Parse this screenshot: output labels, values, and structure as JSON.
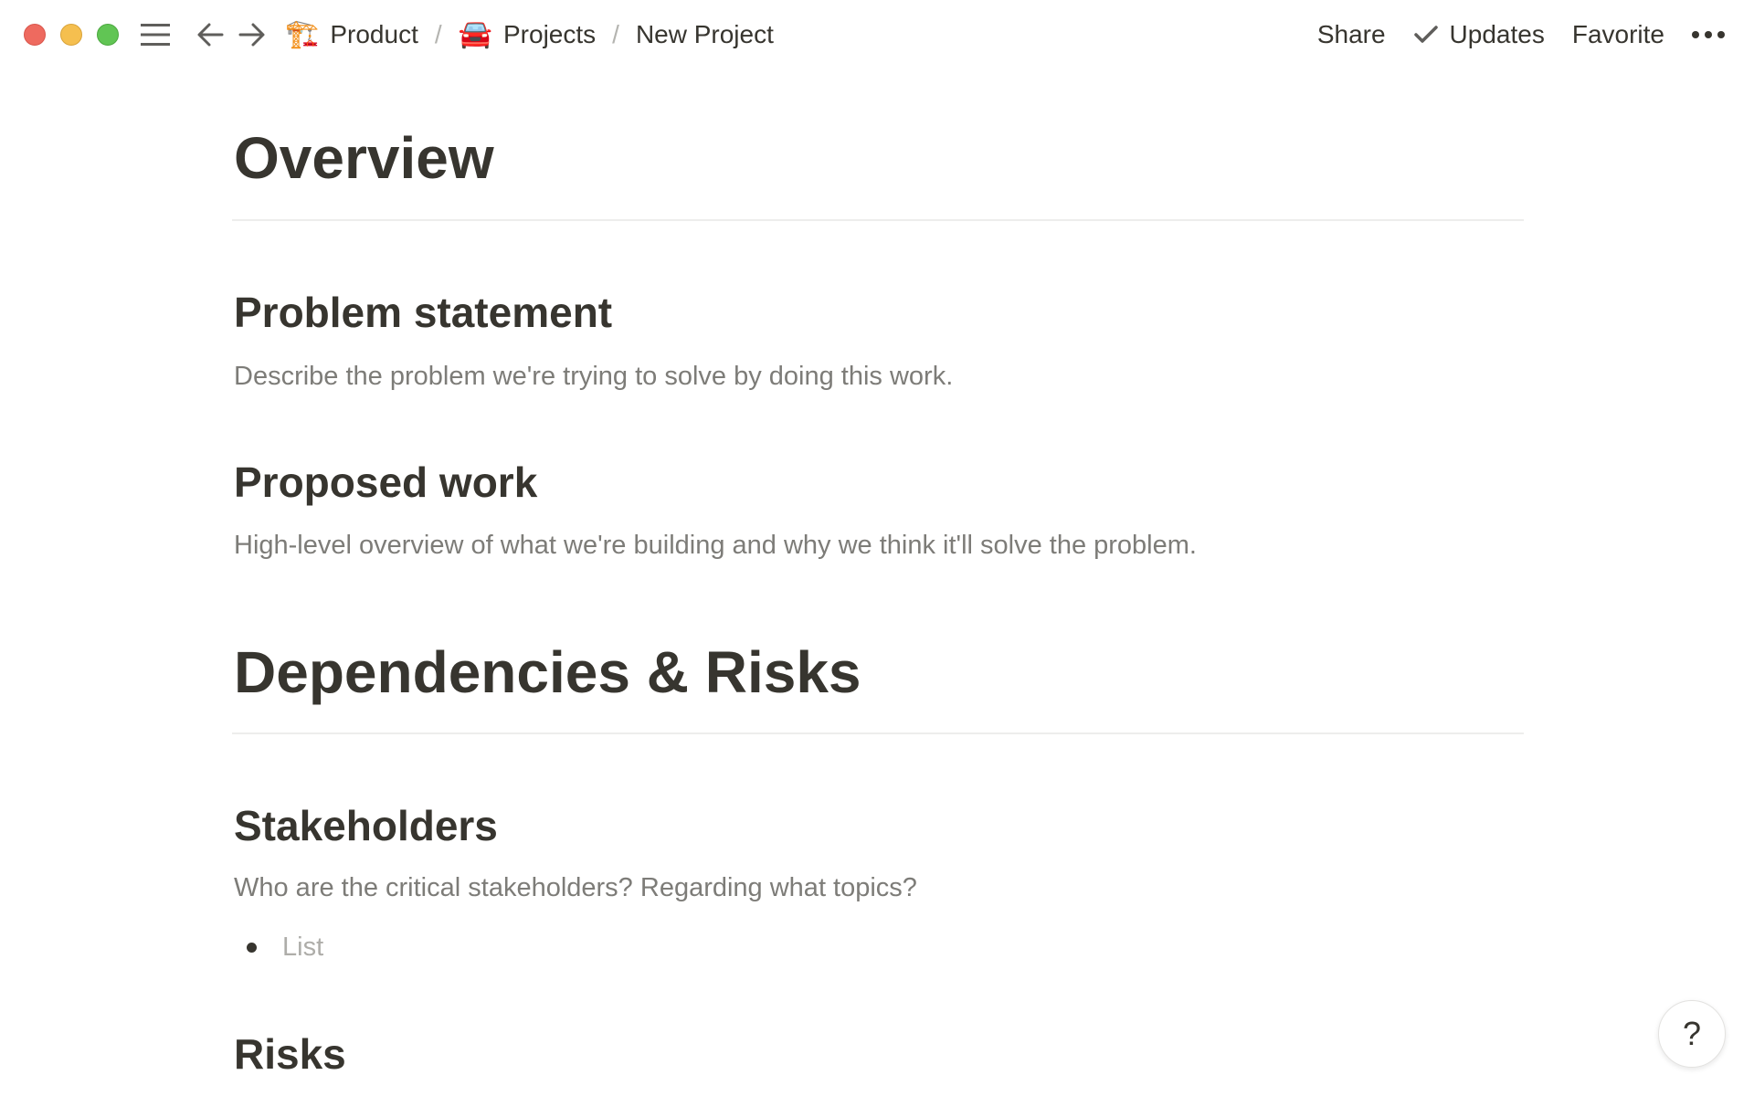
{
  "window": {
    "controls": [
      "close",
      "minimize",
      "zoom"
    ]
  },
  "toolbar": {
    "menu_icon": "hamburger-icon",
    "back_icon": "arrow-left-icon",
    "forward_icon": "arrow-right-icon",
    "breadcrumb": [
      {
        "emoji": "🏗️",
        "label": "Product"
      },
      {
        "emoji": "🚘",
        "label": "Projects"
      },
      {
        "emoji": "",
        "label": "New Project"
      }
    ],
    "separator": "/",
    "actions": {
      "share": "Share",
      "updates": "Updates",
      "favorite": "Favorite"
    }
  },
  "document": {
    "overview": {
      "title": "Overview",
      "problem_statement": {
        "heading": "Problem statement",
        "text": "Describe the problem we're trying to solve by doing this work."
      },
      "proposed_work": {
        "heading": "Proposed work",
        "text": "High-level overview of what we're building and why we think it'll solve the problem."
      }
    },
    "dependencies": {
      "title": "Dependencies & Risks",
      "stakeholders": {
        "heading": "Stakeholders",
        "text": "Who are the critical stakeholders? Regarding what topics?",
        "list_placeholder": "List"
      },
      "risks": {
        "heading": "Risks"
      }
    }
  },
  "help": {
    "label": "?"
  }
}
